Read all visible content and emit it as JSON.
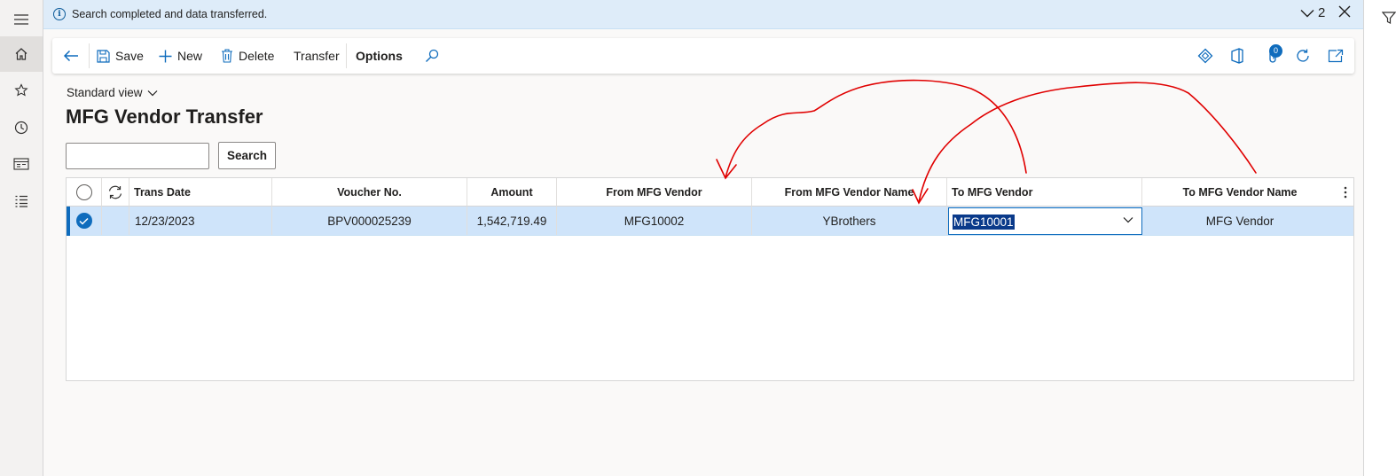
{
  "message": {
    "text": "Search completed and data transferred.",
    "count": "2"
  },
  "toolbar": {
    "save": "Save",
    "new": "New",
    "delete": "Delete",
    "transfer": "Transfer",
    "options": "Options",
    "badge_count": "0"
  },
  "view": {
    "name": "Standard view"
  },
  "page": {
    "title": "MFG Vendor Transfer"
  },
  "search": {
    "button": "Search",
    "value": ""
  },
  "grid": {
    "columns": [
      "Trans Date",
      "Voucher No.",
      "Amount",
      "From MFG Vendor",
      "From MFG Vendor Name",
      "To MFG Vendor",
      "To MFG Vendor Name"
    ],
    "rows": [
      {
        "trans_date": "12/23/2023",
        "voucher_no": "BPV000025239",
        "amount": "1,542,719.49",
        "from_vendor": "MFG10002",
        "from_vendor_name": "YBrothers",
        "to_vendor": "MFG10001",
        "to_vendor_name": "MFG Vendor",
        "selected": true
      }
    ]
  },
  "colors": {
    "accent": "#0f6cbd",
    "selected_row": "#cfe4fa",
    "message_bar": "#deecf9",
    "annotation": "#e00000"
  }
}
